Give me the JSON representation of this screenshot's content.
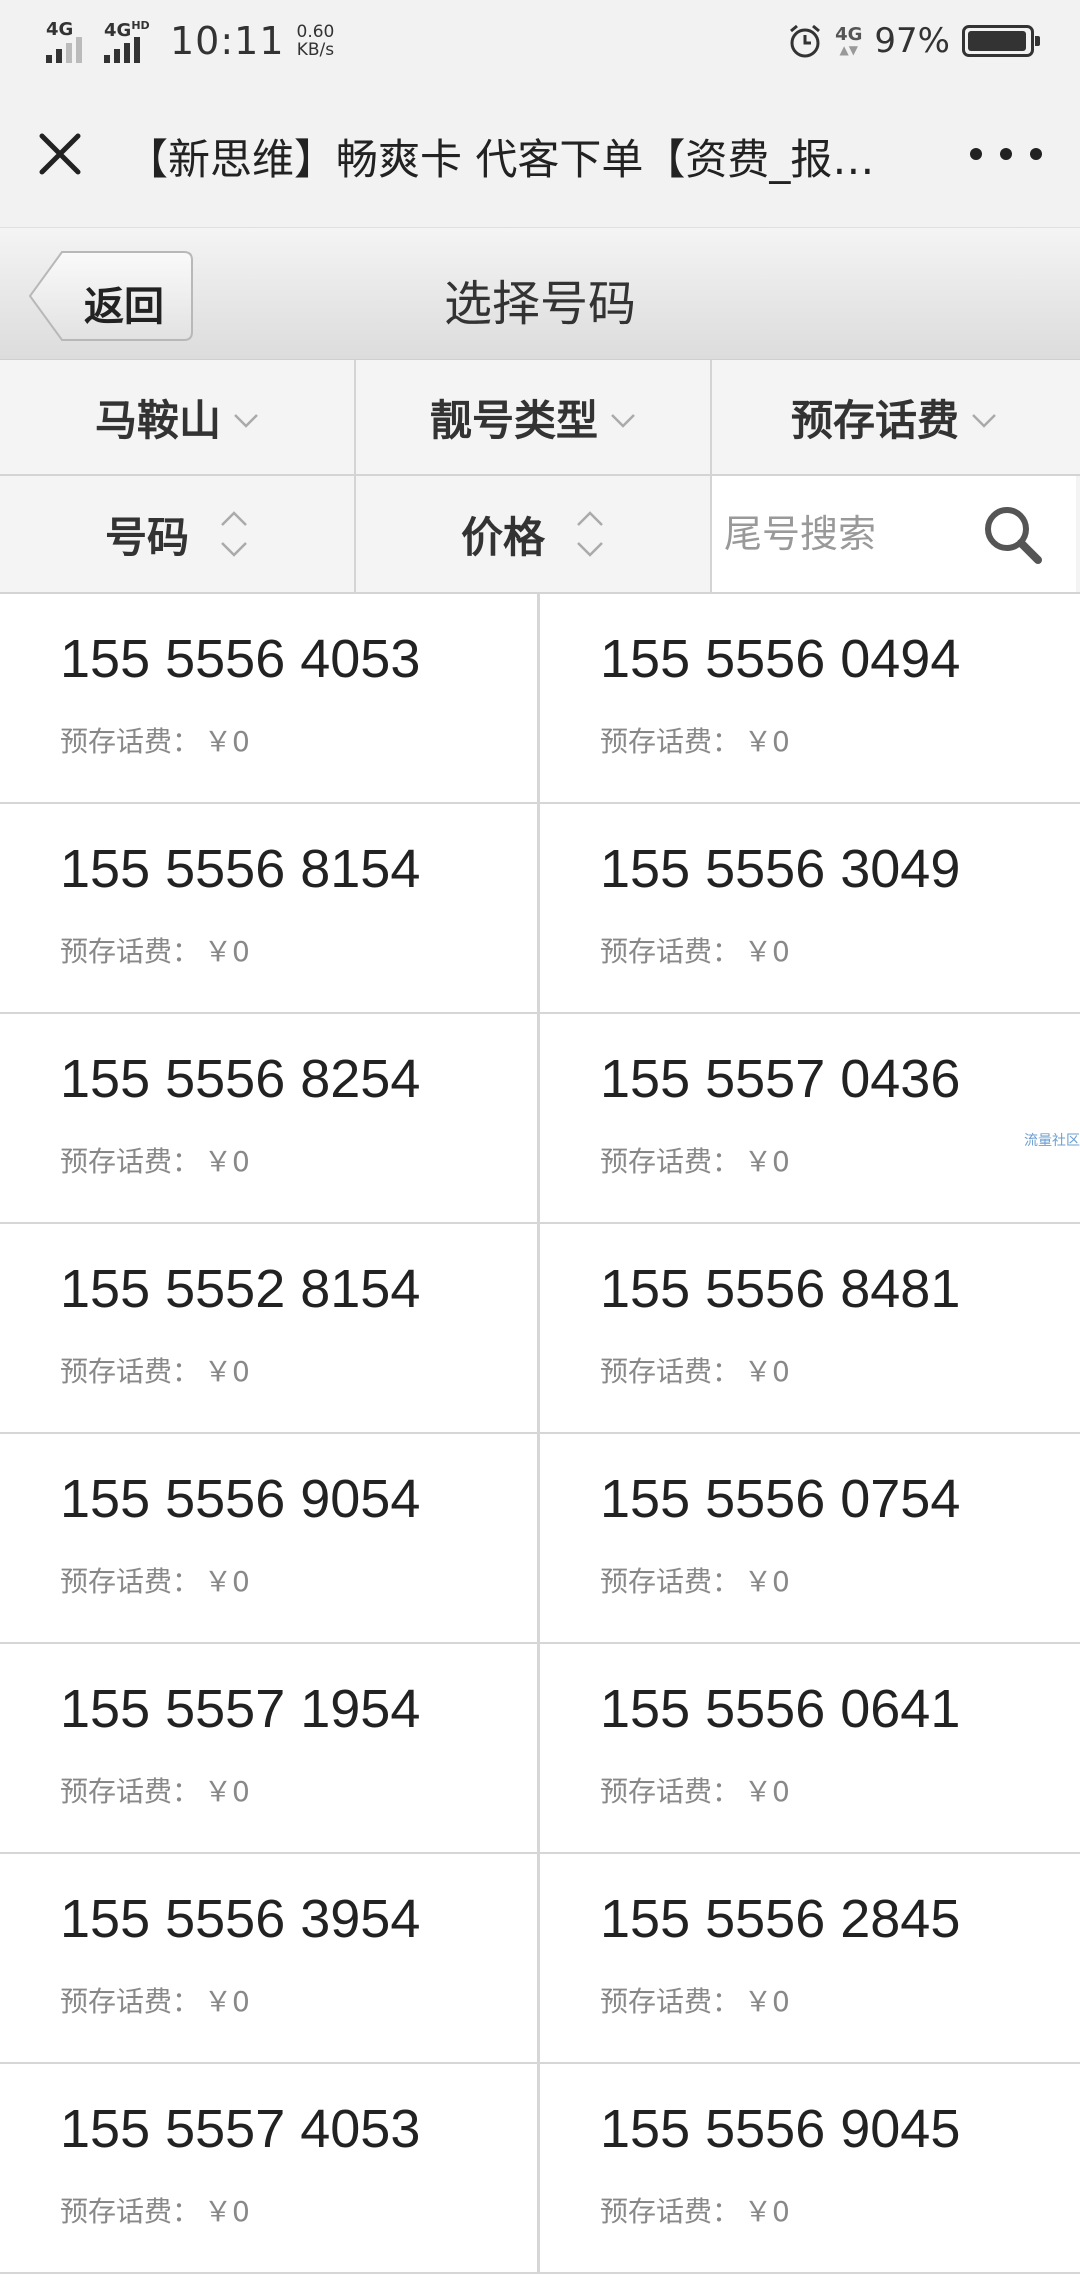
{
  "status_bar": {
    "sim1": "4G",
    "sim2": "4G",
    "sim2_sup": "HD",
    "time": "10:11",
    "speed_value": "0.60",
    "speed_unit": "KB/s",
    "net_label": "4G",
    "battery": "97%",
    "battery_level": 0.97
  },
  "title_bar": {
    "title": "【新思维】畅爽卡 代客下单【资费_报…"
  },
  "header": {
    "back_label": "返回",
    "title": "选择号码"
  },
  "filters": {
    "region": "马鞍山",
    "number_type": "靓号类型",
    "prepay": "预存话费"
  },
  "sort": {
    "number": "号码",
    "price": "价格",
    "search_placeholder": "尾号搜索"
  },
  "fee_label": "预存话费：",
  "numbers": [
    {
      "number": "155 5556 4053",
      "fee": "￥0"
    },
    {
      "number": "155 5556 0494",
      "fee": "￥0"
    },
    {
      "number": "155 5556 8154",
      "fee": "￥0"
    },
    {
      "number": "155 5556 3049",
      "fee": "￥0"
    },
    {
      "number": "155 5556 8254",
      "fee": "￥0"
    },
    {
      "number": "155 5557 0436",
      "fee": "￥0"
    },
    {
      "number": "155 5552 8154",
      "fee": "￥0"
    },
    {
      "number": "155 5556 8481",
      "fee": "￥0"
    },
    {
      "number": "155 5556 9054",
      "fee": "￥0"
    },
    {
      "number": "155 5556 0754",
      "fee": "￥0"
    },
    {
      "number": "155 5557 1954",
      "fee": "￥0"
    },
    {
      "number": "155 5556 0641",
      "fee": "￥0"
    },
    {
      "number": "155 5556 3954",
      "fee": "￥0"
    },
    {
      "number": "155 5556 2845",
      "fee": "￥0"
    },
    {
      "number": "155 5557 4053",
      "fee": "￥0"
    },
    {
      "number": "155 5556 9045",
      "fee": "￥0"
    }
  ],
  "watermark": "流量社区",
  "icons": {
    "close": "close-icon",
    "more": "more-icon",
    "back": "back-arrow-icon",
    "dropdown": "chevron-down-icon",
    "sort": "sort-arrows-icon",
    "search": "search-icon",
    "alarm": "alarm-icon",
    "battery": "battery-icon"
  },
  "colors": {
    "background": "#ffffff",
    "bar": "#f2f2f2",
    "divider": "#d6d6d6",
    "text": "#222222",
    "muted": "#888888"
  }
}
